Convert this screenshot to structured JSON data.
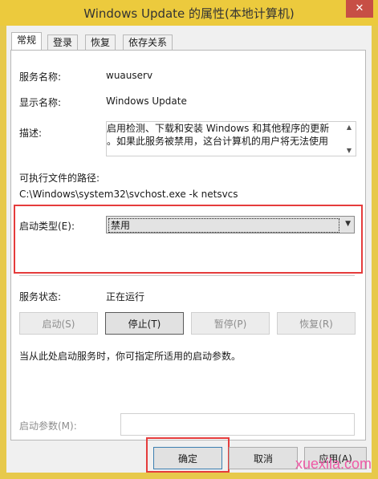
{
  "window": {
    "title": "Windows Update 的属性(本地计算机)"
  },
  "tabs": [
    {
      "label": "常规",
      "active": true
    },
    {
      "label": "登录"
    },
    {
      "label": "恢复"
    },
    {
      "label": "依存关系"
    }
  ],
  "general": {
    "service_name_label": "服务名称:",
    "service_name_value": "wuauserv",
    "display_name_label": "显示名称:",
    "display_name_value": "Windows Update",
    "description_label": "描述:",
    "description_line1": "启用检测、下载和安装 Windows 和其他程序的更新",
    "description_line2": "。如果此服务被禁用，这台计算机的用户将无法使用",
    "exe_path_label": "可执行文件的路径:",
    "exe_path_value": "C:\\Windows\\system32\\svchost.exe -k netsvcs",
    "startup_type_label": "启动类型(E):",
    "startup_type_value": "禁用",
    "service_status_label": "服务状态:",
    "service_status_value": "正在运行",
    "buttons": {
      "start": "启动(S)",
      "stop": "停止(T)",
      "pause": "暂停(P)",
      "resume": "恢复(R)"
    },
    "hint": "当从此处启动服务时，你可指定所适用的启动参数。",
    "start_params_label": "启动参数(M):",
    "start_params_value": ""
  },
  "footer": {
    "ok": "确定",
    "cancel": "取消",
    "apply": "应用(A)"
  },
  "watermark": "xuexila.com",
  "colors": {
    "highlight": "#e53c3c",
    "title_bar": "#ecca3d"
  }
}
